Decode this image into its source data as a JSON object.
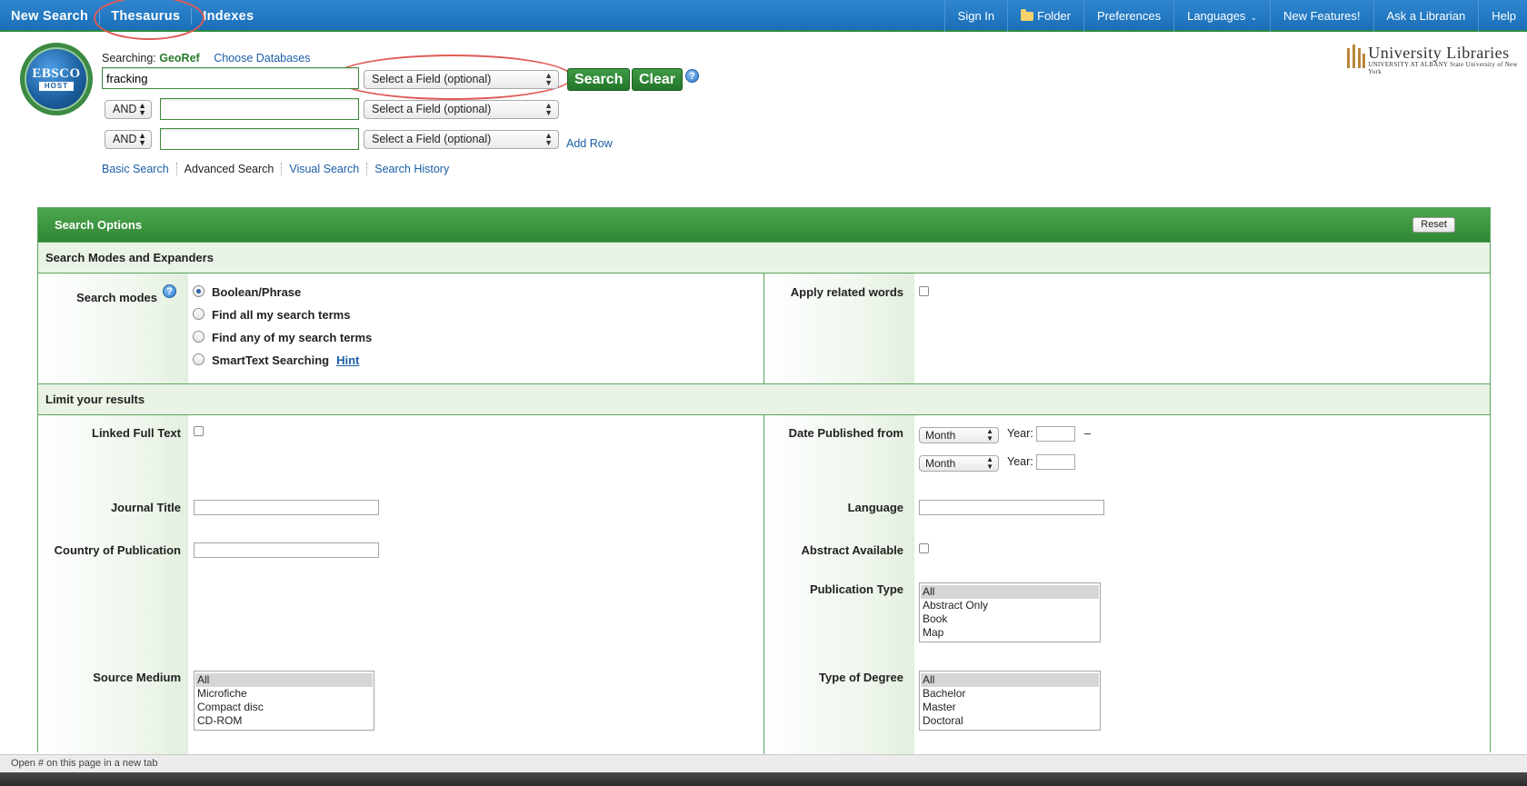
{
  "topnav": {
    "left": [
      "New Search",
      "Thesaurus",
      "Indexes"
    ],
    "right": [
      "Sign In",
      "Folder",
      "Preferences",
      "Languages",
      "New Features!",
      "Ask a Librarian",
      "Help"
    ]
  },
  "logo": {
    "line1": "EBSCO",
    "line2": "HOST"
  },
  "searching": {
    "label": "Searching:",
    "database": "GeoRef",
    "choose": "Choose Databases"
  },
  "search": {
    "rows": [
      {
        "value": "fracking",
        "field": "Select a Field (optional)"
      },
      {
        "bool": "AND",
        "value": "",
        "field": "Select a Field (optional)"
      },
      {
        "bool": "AND",
        "value": "",
        "field": "Select a Field (optional)"
      }
    ],
    "search_btn": "Search",
    "clear_btn": "Clear",
    "help": "?",
    "add_row": "Add Row"
  },
  "modes": [
    "Basic Search",
    "Advanced Search",
    "Visual Search",
    "Search History"
  ],
  "branding": {
    "title": "University Libraries",
    "subtitle": "UNIVERSITY AT ALBANY State University of New York"
  },
  "options": {
    "title": "Search Options",
    "reset": "Reset",
    "modes_section": "Search Modes and Expanders",
    "search_modes_label": "Search modes",
    "search_modes": [
      "Boolean/Phrase",
      "Find all my search terms",
      "Find any of my search terms",
      "SmartText Searching"
    ],
    "hint": "Hint",
    "apply_related": "Apply related words",
    "limit_section": "Limit your results",
    "linked_full_text": "Linked Full Text",
    "journal_title": "Journal Title",
    "country": "Country of Publication",
    "source_medium": "Source Medium",
    "source_medium_options": [
      "All",
      "Microfiche",
      "Compact disc",
      "CD-ROM"
    ],
    "date_published": "Date Published from",
    "month": "Month",
    "year": "Year:",
    "dash": "–",
    "language": "Language",
    "abstract_available": "Abstract Available",
    "publication_type": "Publication Type",
    "publication_type_options": [
      "All",
      "Abstract Only",
      "Book",
      "Map"
    ],
    "type_of_degree": "Type of Degree",
    "type_of_degree_options": [
      "All",
      "Bachelor",
      "Master",
      "Doctoral"
    ]
  },
  "status": "Open # on this page in a new tab",
  "colors": {
    "toolbar": "#1a6fb8",
    "accent_green": "#2f8733",
    "annotation": "#e05a55"
  }
}
